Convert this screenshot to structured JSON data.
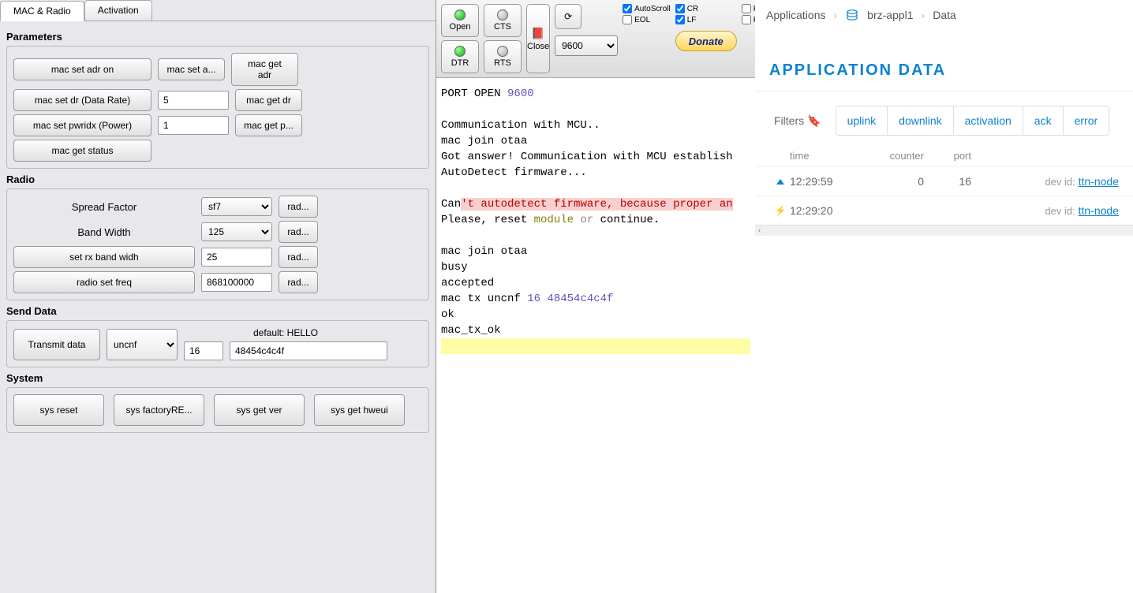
{
  "tabs": {
    "mac_radio": "MAC & Radio",
    "activation": "Activation"
  },
  "parameters": {
    "title": "Parameters",
    "mac_set_adr_on": "mac set adr on",
    "mac_set_a": "mac set a...",
    "mac_get_adr": "mac get adr",
    "mac_set_dr": "mac set dr (Data Rate)",
    "dr_value": "5",
    "mac_get_dr": "mac get dr",
    "mac_set_pwridx": "mac set pwridx (Power)",
    "pwr_value": "1",
    "mac_get_p": "mac get p...",
    "mac_get_status": "mac get status"
  },
  "radio": {
    "title": "Radio",
    "spread_factor_label": "Spread Factor",
    "sf_value": "sf7",
    "band_width_label": "Band Width",
    "bw_value": "125",
    "rad": "rad...",
    "set_rx_bw": "set rx band widh",
    "rx_bw_value": "25",
    "radio_set_freq": "radio set freq",
    "freq_value": "868100000"
  },
  "send": {
    "title": "Send Data",
    "transmit": "Transmit data",
    "mode": "uncnf",
    "default_label": "default: HELLO",
    "port": "16",
    "payload": "48454c4c4f"
  },
  "system": {
    "title": "System",
    "sys_reset": "sys reset",
    "sys_factory": "sys factoryRE...",
    "sys_get_ver": "sys get ver",
    "sys_get_hweui": "sys get hweui"
  },
  "terminal": {
    "open": "Open",
    "cts": "CTS",
    "dtr": "DTR",
    "rts": "RTS",
    "close": "Close",
    "autoscroll": "AutoScroll",
    "cr": "CR",
    "hide1": "Hide",
    "eol": "EOL",
    "lf": "LF",
    "hide2": "Hide",
    "baud": "9600",
    "donate": "Donate",
    "l1a": "PORT OPEN ",
    "l1b": "9600",
    "l3": "Communication with MCU..",
    "l4": "mac join otaa",
    "l5": "Got answer! Communication with MCU establish",
    "l6": "AutoDetect firmware...",
    "l8a": "Can",
    "l8b": "'t autodetect firmware, because proper an",
    "l9a": "Please, reset ",
    "l9b": "module",
    "l9c": " or ",
    "l9d": "continue.",
    "l11": "mac join otaa",
    "l12": "busy",
    "l13": "accepted",
    "l14a": "mac tx uncnf ",
    "l14b": "16",
    "l14c": " 48454c4c4f",
    "l15": "ok",
    "l16": "mac_tx_ok"
  },
  "console": {
    "bc_apps": "Applications",
    "bc_app": "brz-appl1",
    "bc_data": "Data",
    "app_data_title": "APPLICATION DATA",
    "filters_label": "Filters",
    "filter_uplink": "uplink",
    "filter_downlink": "downlink",
    "filter_activation": "activation",
    "filter_ack": "ack",
    "filter_error": "error",
    "hdr_time": "time",
    "hdr_counter": "counter",
    "hdr_port": "port",
    "rows": [
      {
        "time": "12:29:59",
        "counter": "0",
        "port": "16",
        "devid_label": "dev id:",
        "devid": "ttn-node"
      },
      {
        "time": "12:29:20",
        "counter": "",
        "port": "",
        "devid_label": "dev id:",
        "devid": "ttn-node"
      }
    ],
    "scroll_left": "‹"
  }
}
